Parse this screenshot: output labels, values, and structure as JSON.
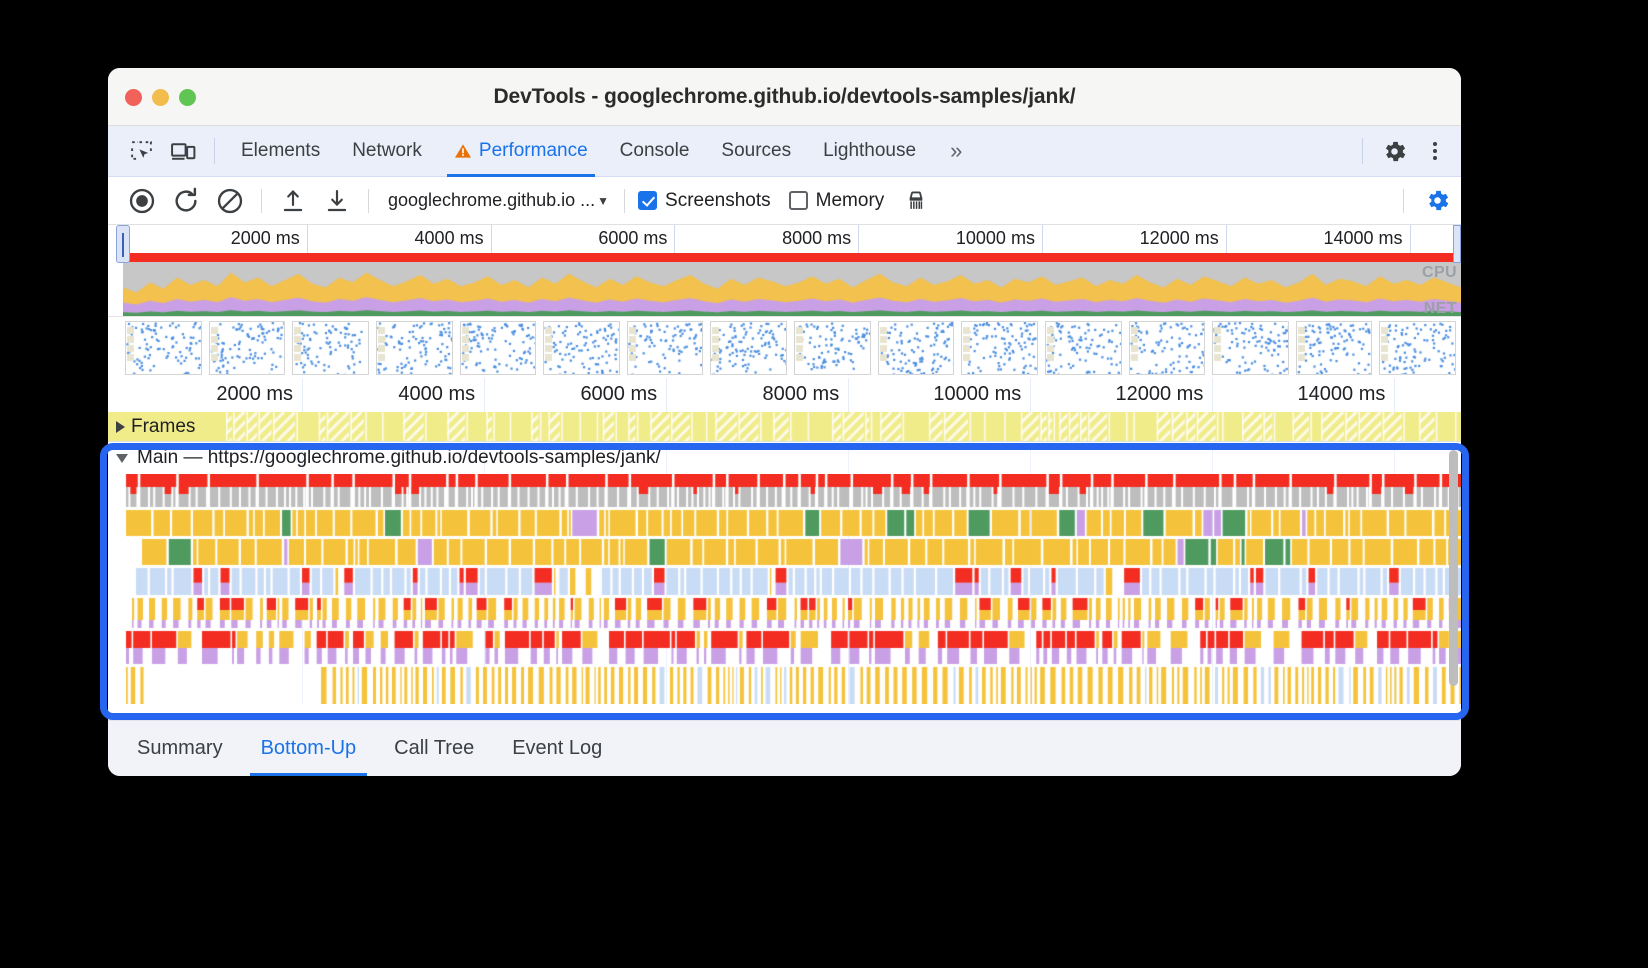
{
  "window": {
    "title": "DevTools - googlechrome.github.io/devtools-samples/jank/",
    "traffic_lights": [
      "close",
      "minimize",
      "zoom"
    ]
  },
  "devtools_tabbar": {
    "icons": [
      "inspect-element-icon",
      "device-toolbar-icon"
    ],
    "tabs": [
      {
        "label": "Elements",
        "active": false,
        "warning": false
      },
      {
        "label": "Network",
        "active": false,
        "warning": false
      },
      {
        "label": "Performance",
        "active": true,
        "warning": true
      },
      {
        "label": "Console",
        "active": false,
        "warning": false
      },
      {
        "label": "Sources",
        "active": false,
        "warning": false
      },
      {
        "label": "Lighthouse",
        "active": false,
        "warning": false
      }
    ],
    "more_tabs_label": "»",
    "settings_label": "Settings",
    "more_options_label": "Customize and control DevTools"
  },
  "perf_toolbar": {
    "record_label": "Record",
    "reload_record_label": "Start profiling and reload page",
    "clear_label": "Clear",
    "upload_label": "Load profile",
    "download_label": "Save profile",
    "url_selector_value": "googlechrome.github.io ...",
    "screenshots": {
      "label": "Screenshots",
      "checked": true
    },
    "memory": {
      "label": "Memory",
      "checked": false
    },
    "collect_garbage_label": "Collect garbage",
    "capture_settings_label": "Capture settings",
    "accent_color": "#1a73e8"
  },
  "overview": {
    "ruler_ticks": [
      "2000 ms",
      "4000 ms",
      "6000 ms",
      "8000 ms",
      "10000 ms",
      "12000 ms",
      "14000 ms"
    ],
    "cpu_label": "CPU",
    "net_label": "NET",
    "long_task_bar_color": "#f32d22",
    "cpu_colors": {
      "idle": "#c7c7c7",
      "scripting": "#f2c14e",
      "rendering": "#c9a0e5",
      "painting": "#4f9a5e",
      "loading": "#83b5f0"
    },
    "cpu_series": [
      18,
      14,
      22,
      17,
      26,
      20,
      24,
      19,
      30,
      22,
      26,
      19,
      24,
      29,
      21,
      18,
      26,
      22,
      30,
      24,
      19,
      23,
      28,
      21,
      25,
      19,
      22,
      27,
      20,
      24,
      18,
      26,
      21,
      29,
      23,
      18,
      25,
      20,
      27,
      22,
      19,
      24,
      28,
      21,
      17,
      25,
      20,
      26,
      23,
      19,
      22,
      27,
      21,
      25,
      18,
      24,
      29,
      22,
      19,
      26,
      20,
      23,
      28,
      21,
      24,
      18,
      25,
      22,
      27,
      20,
      23,
      26,
      19,
      24,
      21,
      28,
      22,
      18,
      25,
      20,
      27,
      23,
      19,
      26,
      21,
      24,
      18,
      22,
      29,
      20,
      25,
      23,
      19,
      27,
      21,
      24,
      20,
      26,
      22,
      18
    ],
    "frame_thumbnail_count": 16
  },
  "flame": {
    "ruler_ticks": [
      "2000 ms",
      "4000 ms",
      "6000 ms",
      "8000 ms",
      "10000 ms",
      "12000 ms",
      "14000 ms"
    ],
    "frames_track": {
      "label": "Frames",
      "expanded": false,
      "color": "#f1ec8a"
    },
    "main_track": {
      "label": "Main — https://googlechrome.github.io/devtools-samples/jank/",
      "expanded": true,
      "selected": true,
      "selection_color": "#2565f0"
    },
    "event_colors": {
      "long_task": "#f32d22",
      "task": "#bdbdbd",
      "scripting": "#f5c33b",
      "rendering": "#c9a0e5",
      "painting": "#4f9a5e",
      "loading": "#c9dcf5"
    }
  },
  "bottom_tabs": [
    {
      "label": "Summary",
      "active": false
    },
    {
      "label": "Bottom-Up",
      "active": true
    },
    {
      "label": "Call Tree",
      "active": false
    },
    {
      "label": "Event Log",
      "active": false
    }
  ]
}
